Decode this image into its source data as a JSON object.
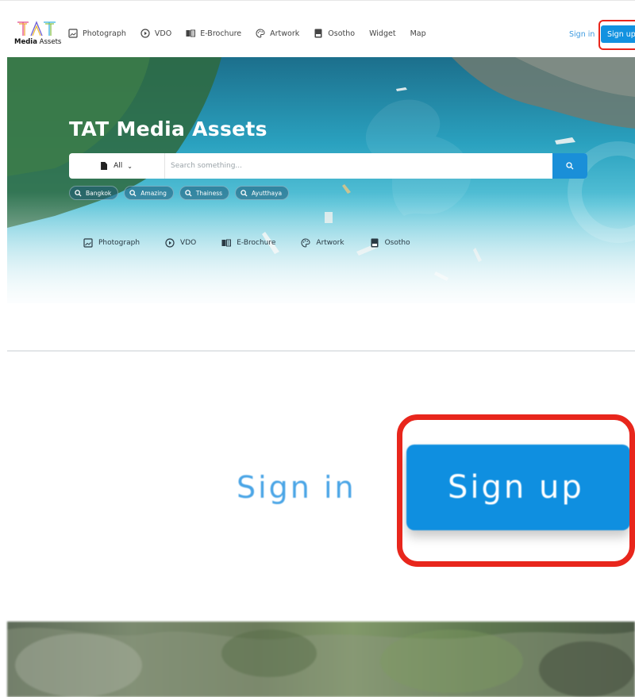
{
  "brand": {
    "logo_text_bold": "Media",
    "logo_text_rest": " Assets",
    "logo_letters": "TAT"
  },
  "nav": {
    "items": [
      {
        "label": "Photograph",
        "icon": "image-icon"
      },
      {
        "label": "VDO",
        "icon": "play-circle-icon"
      },
      {
        "label": "E-Brochure",
        "icon": "book-icon"
      },
      {
        "label": "Artwork",
        "icon": "palette-icon"
      },
      {
        "label": "Osotho",
        "icon": "notebook-icon"
      },
      {
        "label": "Widget",
        "icon": ""
      },
      {
        "label": "Map",
        "icon": ""
      }
    ],
    "signin_label": "Sign in",
    "signup_label": "Sign up"
  },
  "hero": {
    "title": "TAT Media Assets",
    "search": {
      "category_value": "All",
      "placeholder": "Search something..."
    },
    "tags": [
      "Bangkok",
      "Amazing",
      "Thainess",
      "Ayutthaya"
    ],
    "categories": [
      {
        "label": "Photograph",
        "icon": "image-icon"
      },
      {
        "label": "VDO",
        "icon": "play-circle-icon"
      },
      {
        "label": "E-Brochure",
        "icon": "book-icon"
      },
      {
        "label": "Artwork",
        "icon": "palette-icon"
      },
      {
        "label": "Osotho",
        "icon": "notebook-icon"
      }
    ]
  },
  "zoom": {
    "signin_label": "Sign in",
    "signup_label": "Sign up"
  },
  "colors": {
    "accent": "#1292e0",
    "highlight": "#e8261c",
    "link": "#3e9be0"
  }
}
